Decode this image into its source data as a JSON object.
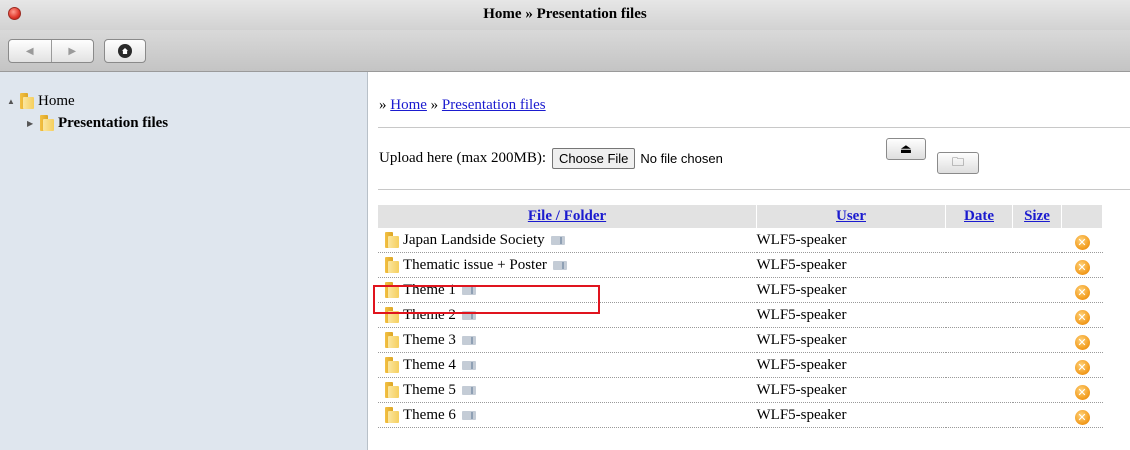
{
  "window": {
    "title": "Home » Presentation files"
  },
  "toolbar": {
    "back_icon": "triangle-left-icon",
    "forward_icon": "triangle-right-icon",
    "home_icon": "home-icon"
  },
  "sidebar": {
    "items": [
      {
        "label": "Home",
        "expanded": true
      },
      {
        "label": "Presentation files",
        "selected": true
      }
    ]
  },
  "main": {
    "breadcrumb": {
      "prefix": "» ",
      "sep": " » ",
      "items": [
        "Home",
        "Presentation files"
      ]
    },
    "upload": {
      "label": "Upload here (max 200MB):",
      "choose_label": "Choose File",
      "status": "No file chosen"
    },
    "table": {
      "headers": [
        "File / Folder",
        "User",
        "Date",
        "Size"
      ],
      "rows": [
        {
          "name": "Japan Landside Society",
          "user": "WLF5-speaker"
        },
        {
          "name": "Thematic issue + Poster",
          "user": "WLF5-speaker"
        },
        {
          "name": "Theme 1",
          "user": "WLF5-speaker"
        },
        {
          "name": "Theme 2",
          "user": "WLF5-speaker"
        },
        {
          "name": "Theme 3",
          "user": "WLF5-speaker"
        },
        {
          "name": "Theme 4",
          "user": "WLF5-speaker"
        },
        {
          "name": "Theme 5",
          "user": "WLF5-speaker"
        },
        {
          "name": "Theme 6",
          "user": "WLF5-speaker"
        }
      ],
      "delete_glyph": "✕"
    },
    "colors": {
      "link": "#1b1bcf",
      "highlight": "#e0141e",
      "sidebar_bg": "#dfe6ee"
    }
  }
}
